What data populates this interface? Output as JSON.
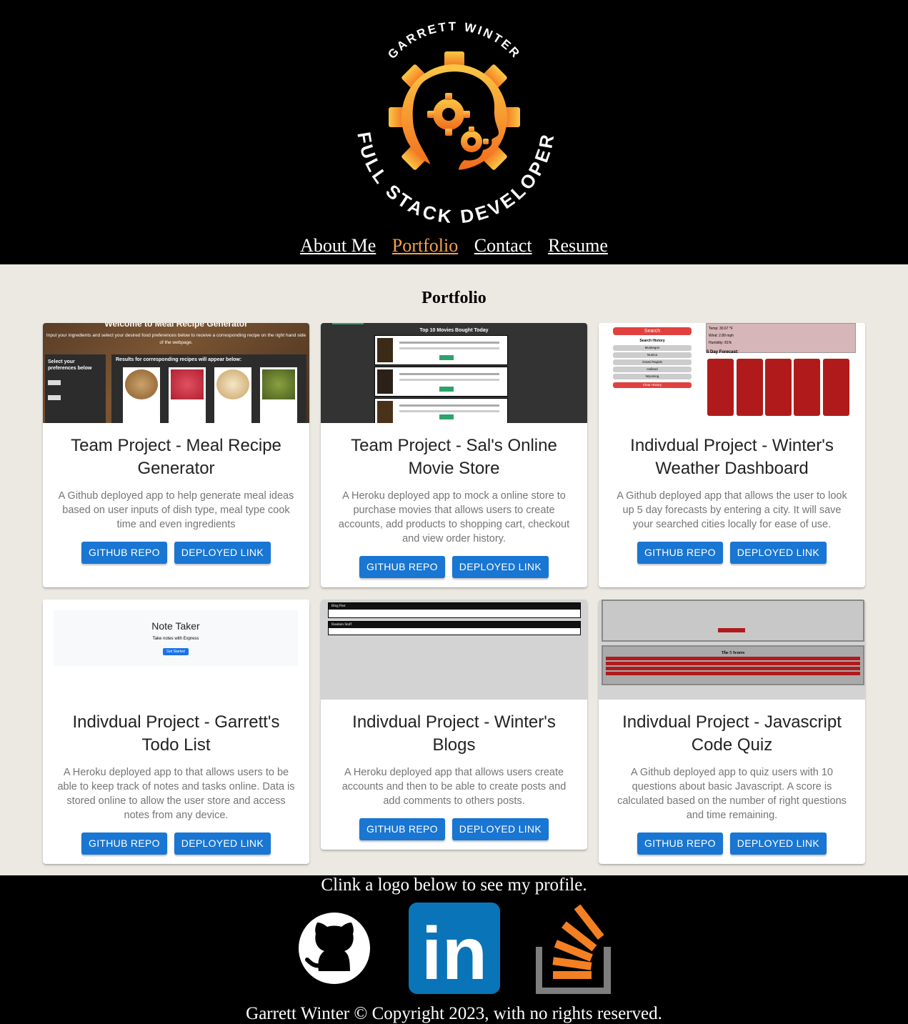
{
  "header": {
    "logo_top_text": "GARRETT WINTER",
    "logo_bottom_text": "FULL STACK DEVELOPER",
    "nav": [
      {
        "label": "About Me",
        "active": false
      },
      {
        "label": "Portfolio",
        "active": true
      },
      {
        "label": "Contact",
        "active": false
      },
      {
        "label": "Resume",
        "active": false
      }
    ]
  },
  "portfolio": {
    "title": "Portfolio",
    "projects": [
      {
        "title": "Team Project - Meal Recipe Generator",
        "description": "A Github deployed app to help generate meal ideas based on user inputs of dish type, meal type cook time and even ingredients",
        "buttons": [
          "GITHUB REPO",
          "DEPLOYED LINK"
        ]
      },
      {
        "title": "Team Project - Sal's Online Movie Store",
        "description": "A Heroku deployed app to mock a online store to purchase movies that allows users to create accounts, add products to shopping cart, checkout and view order history.",
        "buttons": [
          "GITHUB REPO",
          "DEPLOYED LINK"
        ]
      },
      {
        "title": "Indivdual Project - Winter's Weather Dashboard",
        "description": "A Github deployed app that allows the user to look up 5 day forecasts by entering a city. It will save your searched cities locally for ease of use.",
        "buttons": [
          "GITHUB REPO",
          "DEPLOYED LINK"
        ]
      },
      {
        "title": "Indivdual Project - Garrett's Todo List",
        "description": "A Heroku deployed app to that allows users to be able to keep track of notes and tasks online. Data is stored online to allow the user store and access notes from any device.",
        "buttons": [
          "GITHUB REPO",
          "DEPLOYED LINK"
        ]
      },
      {
        "title": "Indivdual Project - Winter's Blogs",
        "description": "A Heroku deployed app that allows users create accounts and then to be able to create posts and add comments to others posts.",
        "buttons": [
          "GITHUB REPO",
          "DEPLOYED LINK"
        ]
      },
      {
        "title": "Indivdual Project - Javascript Code Quiz",
        "description": "A Github deployed app to quiz users with 10 questions about basic Javascript. A score is calculated based on the number of right questions and time remaining.",
        "buttons": [
          "GITHUB REPO",
          "DEPLOYED LINK"
        ]
      }
    ]
  },
  "thumbs": {
    "meal": {
      "banner": "Welcome to Meal Recipe Generator",
      "intro": "Input your ingredients and select your desired food preferences below to receive a corresponding recipe on the right hand side of the webpage.",
      "prefs_heading": "Select your preferences below",
      "results_heading": "Results for corresponding recipes will appear below:"
    },
    "movie": {
      "heading": "Top 10 Movies Bought Today"
    },
    "weather": {
      "search_button": "Search",
      "history_label": "Search History",
      "cities": [
        "Muskegon",
        "Nunica",
        "Grand Rapids",
        "Holland",
        "Wyoming"
      ],
      "clear_button": "Clear History",
      "temp": "Temp: 30.67 °F",
      "wind": "Wind: 2.89 mph",
      "humidity": "Humidity: 81%",
      "forecast_label": "5 Day Forecast:"
    },
    "todo": {
      "title": "Note Taker",
      "subtitle": "Take notes with Express",
      "button": "Get Started"
    },
    "blog": {
      "post1_title": "Blog Post",
      "post2_title": "Random Stuff"
    },
    "quiz": {
      "heading": "The 5 Scores"
    }
  },
  "footer": {
    "cta": "Clink a logo below to see my profile.",
    "copyright": "Garrett Winter © Copyright 2023, with no rights reserved.",
    "profiles": [
      "github",
      "linkedin",
      "stackoverflow"
    ],
    "linkedin_text": "in"
  },
  "colors": {
    "header_bg": "#000000",
    "page_bg": "#ebe9e2",
    "accent": "#f5a14a",
    "button": "#1976d2",
    "linkedin": "#0a74b8",
    "stackoverflow": "#f48024"
  }
}
